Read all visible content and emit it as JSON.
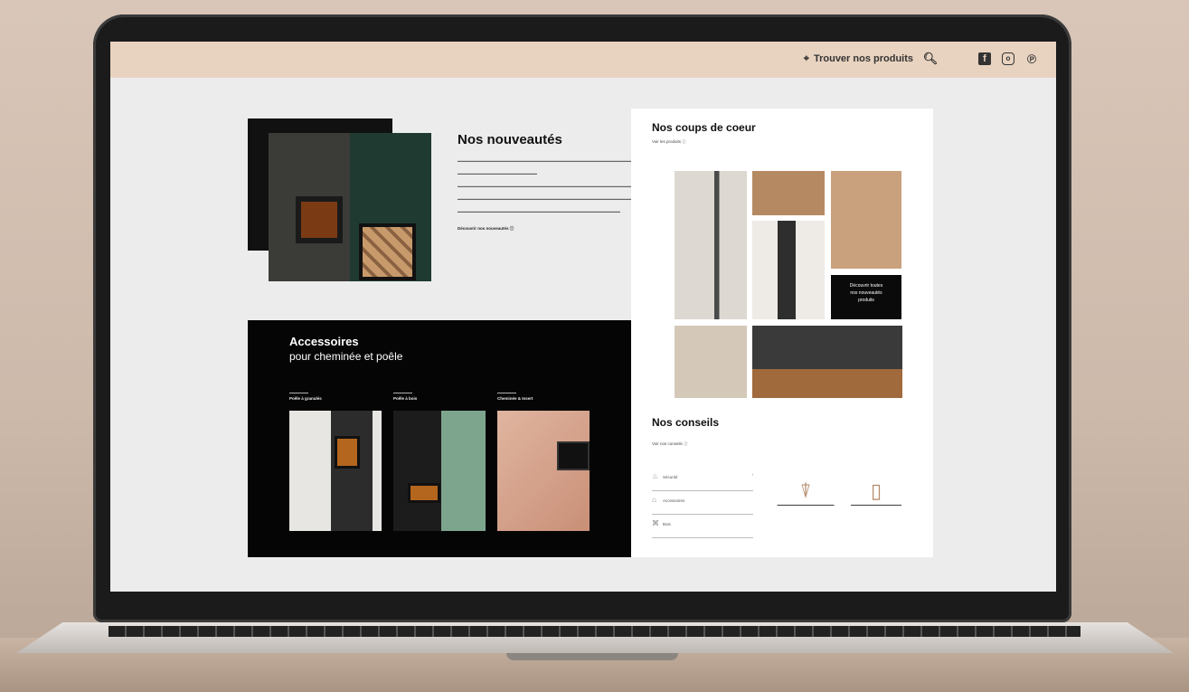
{
  "header": {
    "find_label": "Trouver nos produits",
    "find_icon": "location-pin-icon",
    "search_icon": "search-icon",
    "social": [
      "facebook-icon",
      "instagram-icon",
      "pinterest-icon"
    ]
  },
  "news": {
    "title": "Nos nouveautés",
    "more_label": "Découvrir nos nouveautés"
  },
  "accessories": {
    "title_line1": "Accessoires",
    "title_line2": "pour cheminée et poêle",
    "categories": [
      {
        "label": "Poêle à granulés"
      },
      {
        "label": "Poêle à bois"
      },
      {
        "label": "Cheminée & Insert"
      }
    ]
  },
  "favorites": {
    "title": "Nos coups de coeur",
    "link_label": "Voir les produits",
    "promo_lines": [
      "Découvrir toutes",
      "nos nouveautés",
      "produits"
    ]
  },
  "advice": {
    "title": "Nos conseils",
    "link_label": "Voir nos conseils",
    "tips": [
      "Sécurité",
      "Accessoires",
      "Bois"
    ]
  },
  "colors": {
    "topbar": "#e8d3c0",
    "accent": "#b38a6a",
    "dark_panel": "#050505"
  }
}
